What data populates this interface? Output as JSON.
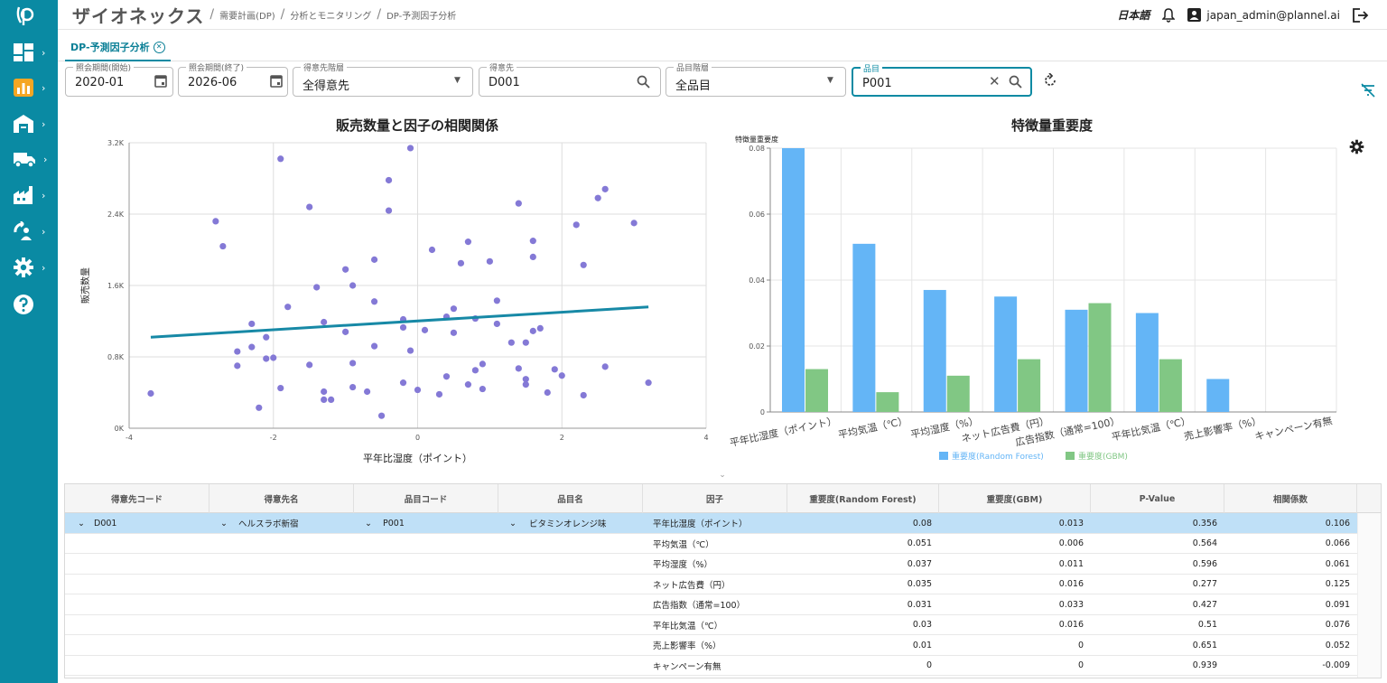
{
  "header": {
    "brand": "ザイオネックス",
    "breadcrumbs": [
      "需要計画(DP)",
      "分析とモニタリング",
      "DP-予測因子分析"
    ],
    "language": "日本語",
    "user": "japan_admin@plannel.ai"
  },
  "tab": {
    "label": "DP-予測因子分析"
  },
  "filters": {
    "start": {
      "label": "照会期間(開始)",
      "value": "2020-01"
    },
    "end": {
      "label": "照会期間(終了)",
      "value": "2026-06"
    },
    "customer_level": {
      "label": "得意先階層",
      "value": "全得意先"
    },
    "customer": {
      "label": "得意先",
      "value": "D001"
    },
    "item_level": {
      "label": "品目階層",
      "value": "全品目"
    },
    "item": {
      "label": "品目",
      "value": "P001"
    }
  },
  "chart_data": [
    {
      "type": "scatter",
      "title": "販売数量と因子の相関関係",
      "xlabel": "平年比湿度（ポイント）",
      "ylabel": "販売数量",
      "xlim": [
        -4,
        4
      ],
      "ylim": [
        0,
        3200
      ],
      "xticks": [
        "-4",
        "-2",
        "0",
        "2",
        "4"
      ],
      "yticks": [
        "0K",
        "0.8K",
        "1.6K",
        "2.4K",
        "3.2K"
      ],
      "grid": true,
      "points": [
        [
          -3.7,
          390
        ],
        [
          -2.8,
          2320
        ],
        [
          -2.7,
          2040
        ],
        [
          -2.5,
          860
        ],
        [
          -2.5,
          700
        ],
        [
          -2.3,
          1170
        ],
        [
          -2.3,
          910
        ],
        [
          -2.2,
          230
        ],
        [
          -2.1,
          780
        ],
        [
          -2.1,
          1020
        ],
        [
          -2.0,
          790
        ],
        [
          -1.9,
          3020
        ],
        [
          -1.9,
          450
        ],
        [
          -1.8,
          1360
        ],
        [
          -1.5,
          2480
        ],
        [
          -1.5,
          710
        ],
        [
          -1.4,
          1580
        ],
        [
          -1.3,
          1190
        ],
        [
          -1.3,
          410
        ],
        [
          -1.3,
          320
        ],
        [
          -1.2,
          320
        ],
        [
          -1.0,
          1780
        ],
        [
          -1.0,
          1080
        ],
        [
          -0.9,
          1600
        ],
        [
          -0.9,
          730
        ],
        [
          -0.9,
          460
        ],
        [
          -0.7,
          410
        ],
        [
          -0.6,
          1890
        ],
        [
          -0.6,
          1420
        ],
        [
          -0.6,
          920
        ],
        [
          -0.5,
          140
        ],
        [
          -0.4,
          2780
        ],
        [
          -0.4,
          2440
        ],
        [
          -0.2,
          1220
        ],
        [
          -0.2,
          1130
        ],
        [
          -0.2,
          510
        ],
        [
          -0.1,
          3140
        ],
        [
          -0.1,
          870
        ],
        [
          0.0,
          430
        ],
        [
          0.1,
          1100
        ],
        [
          0.2,
          2000
        ],
        [
          0.3,
          380
        ],
        [
          0.4,
          1250
        ],
        [
          0.4,
          580
        ],
        [
          0.5,
          1340
        ],
        [
          0.5,
          1070
        ],
        [
          0.6,
          1850
        ],
        [
          0.7,
          2090
        ],
        [
          0.7,
          490
        ],
        [
          0.8,
          650
        ],
        [
          0.8,
          1230
        ],
        [
          0.9,
          720
        ],
        [
          0.9,
          440
        ],
        [
          1.0,
          1870
        ],
        [
          1.1,
          1430
        ],
        [
          1.1,
          1170
        ],
        [
          1.3,
          960
        ],
        [
          1.4,
          2520
        ],
        [
          1.4,
          670
        ],
        [
          1.5,
          550
        ],
        [
          1.5,
          960
        ],
        [
          1.5,
          490
        ],
        [
          1.6,
          2100
        ],
        [
          1.6,
          1920
        ],
        [
          1.6,
          1090
        ],
        [
          1.7,
          1120
        ],
        [
          1.8,
          400
        ],
        [
          1.9,
          660
        ],
        [
          2.0,
          590
        ],
        [
          2.2,
          2280
        ],
        [
          2.3,
          1830
        ],
        [
          2.3,
          370
        ],
        [
          2.5,
          2580
        ],
        [
          2.6,
          2680
        ],
        [
          2.6,
          690
        ],
        [
          3.0,
          2300
        ],
        [
          3.2,
          510
        ]
      ],
      "trendline": [
        [
          -3.7,
          1020
        ],
        [
          3.2,
          1360
        ]
      ]
    },
    {
      "type": "bar",
      "title": "特徴量重要度",
      "ylabel": "特徴量重要度",
      "ylim": [
        0,
        0.08
      ],
      "yticks": [
        "0",
        "0.02",
        "0.04",
        "0.06",
        "0.08"
      ],
      "categories": [
        "平年比湿度（ポイント）",
        "平均気温（℃）",
        "平均湿度（%）",
        "ネット広告費（円）",
        "広告指数（通常=100）",
        "平年比気温（℃）",
        "売上影響率（%）",
        "キャンペーン有無"
      ],
      "series": [
        {
          "name": "重要度(Random Forest)",
          "color": "#64b5f6",
          "values": [
            0.08,
            0.051,
            0.037,
            0.035,
            0.031,
            0.03,
            0.01,
            0
          ]
        },
        {
          "name": "重要度(GBM)",
          "color": "#81c784",
          "values": [
            0.013,
            0.006,
            0.011,
            0.016,
            0.033,
            0.016,
            0,
            0
          ]
        }
      ],
      "legend": "bottom"
    }
  ],
  "table": {
    "columns": [
      "得意先コード",
      "得意先名",
      "品目コード",
      "品目名",
      "因子",
      "重要度(Random Forest)",
      "重要度(GBM)",
      "P-Value",
      "相関係数"
    ],
    "group": {
      "customer_code": "D001",
      "customer_name": "ヘルスラボ新宿",
      "item_code": "P001",
      "item_name": "ビタミンオレンジ味"
    },
    "rows": [
      {
        "factor": "平年比湿度（ポイント）",
        "rf": "0.08",
        "gbm": "0.013",
        "p": "0.356",
        "corr": "0.106"
      },
      {
        "factor": "平均気温（℃）",
        "rf": "0.051",
        "gbm": "0.006",
        "p": "0.564",
        "corr": "0.066"
      },
      {
        "factor": "平均湿度（%）",
        "rf": "0.037",
        "gbm": "0.011",
        "p": "0.596",
        "corr": "0.061"
      },
      {
        "factor": "ネット広告費（円）",
        "rf": "0.035",
        "gbm": "0.016",
        "p": "0.277",
        "corr": "0.125"
      },
      {
        "factor": "広告指数（通常=100）",
        "rf": "0.031",
        "gbm": "0.033",
        "p": "0.427",
        "corr": "0.091"
      },
      {
        "factor": "平年比気温（℃）",
        "rf": "0.03",
        "gbm": "0.016",
        "p": "0.51",
        "corr": "0.076"
      },
      {
        "factor": "売上影響率（%）",
        "rf": "0.01",
        "gbm": "0",
        "p": "0.651",
        "corr": "0.052"
      },
      {
        "factor": "キャンペーン有無",
        "rf": "0",
        "gbm": "0",
        "p": "0.939",
        "corr": "-0.009"
      }
    ]
  }
}
